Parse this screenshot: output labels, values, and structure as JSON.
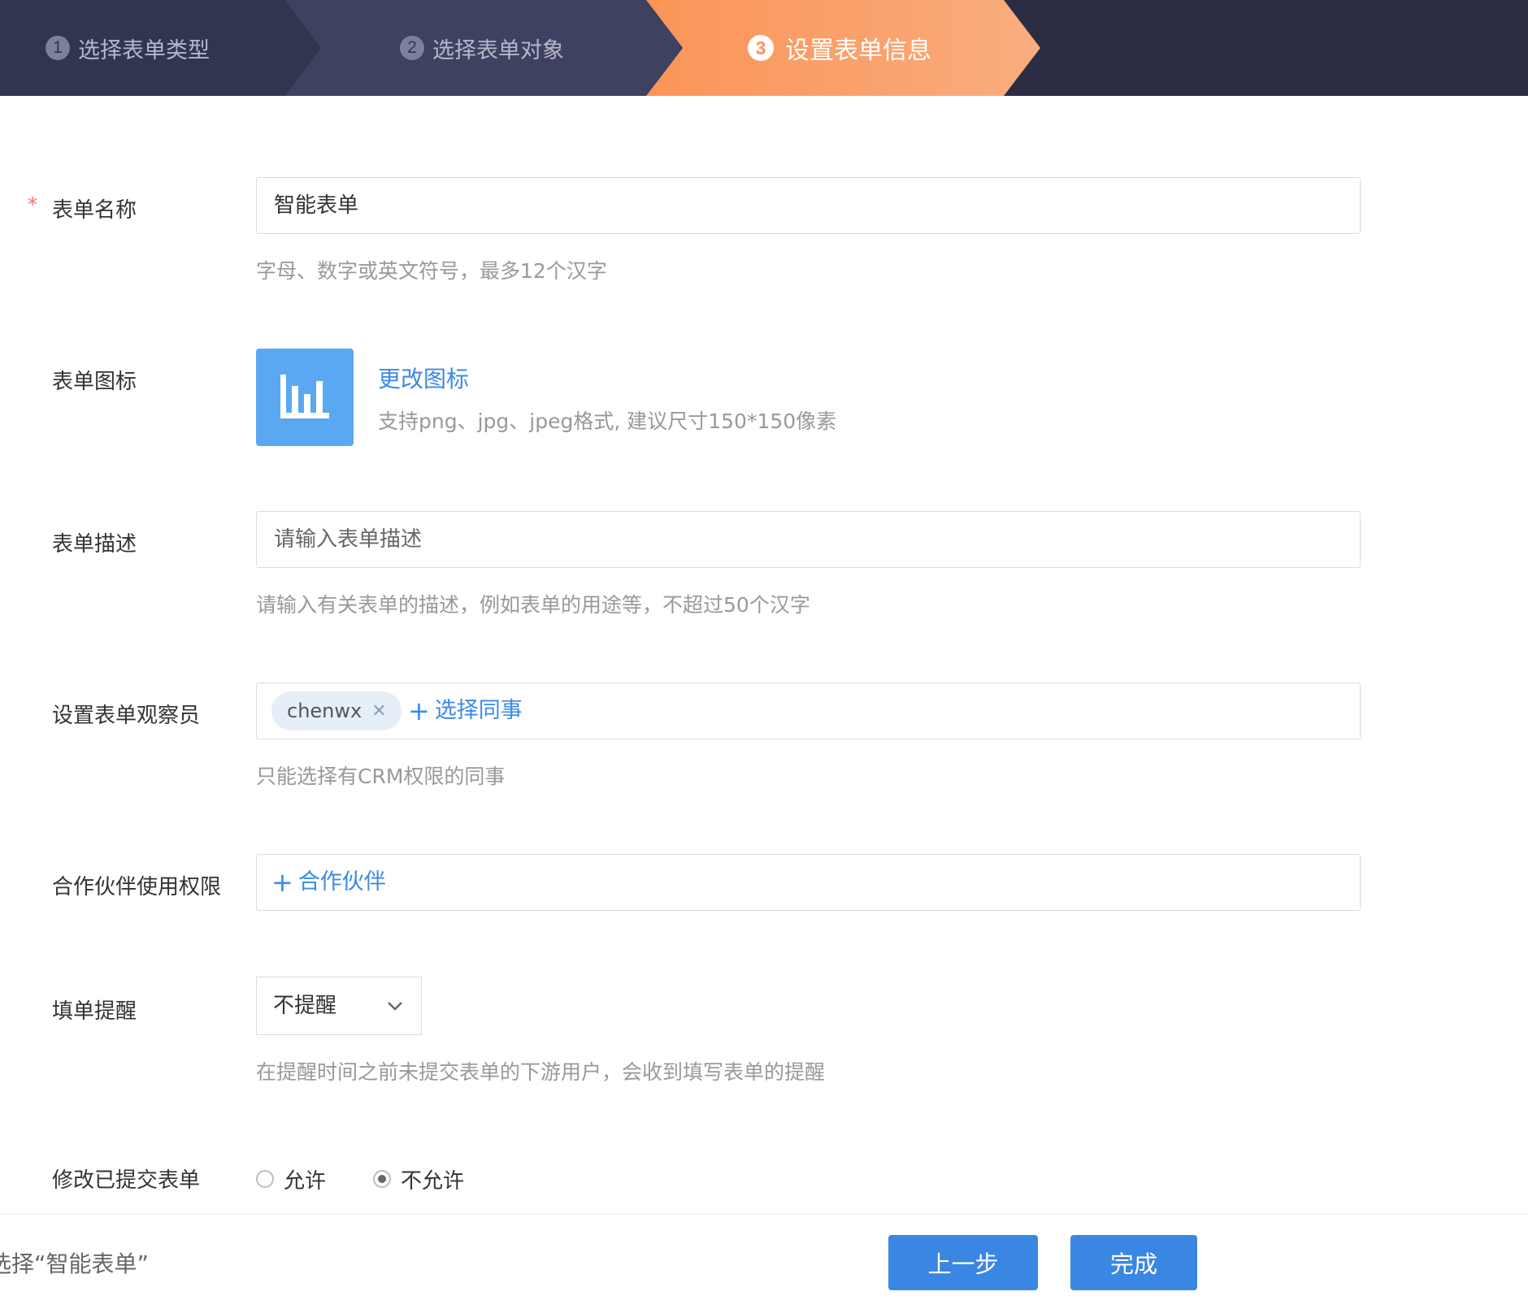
{
  "steps": [
    {
      "number": "1",
      "label": "选择表单类型"
    },
    {
      "number": "2",
      "label": "选择表单对象"
    },
    {
      "number": "3",
      "label": "设置表单信息"
    }
  ],
  "form": {
    "name": {
      "required_mark": "*",
      "label": "表单名称",
      "value": "智能表单",
      "hint": "字母、数字或英文符号，最多12个汉字"
    },
    "icon": {
      "label": "表单图标",
      "change_link": "更改图标",
      "hint": "支持png、jpg、jpeg格式, 建议尺寸150*150像素",
      "icon_name": "bar-chart-icon",
      "color": "#5aa8f2"
    },
    "description": {
      "label": "表单描述",
      "placeholder": "请输入表单描述",
      "hint": "请输入有关表单的描述，例如表单的用途等，不超过50个汉字"
    },
    "observers": {
      "label": "设置表单观察员",
      "tag": "chenwx",
      "tag_close": "✕",
      "add_link": "选择同事",
      "hint": "只能选择有CRM权限的同事"
    },
    "partner": {
      "label": "合作伙伴使用权限",
      "add_link": "合作伙伴"
    },
    "reminder": {
      "label": "填单提醒",
      "selected": "不提醒",
      "hint": "在提醒时间之前未提交表单的下游用户，会收到填写表单的提醒"
    },
    "modify": {
      "label": "修改已提交表单",
      "options": [
        "允许",
        "不允许"
      ],
      "selected": "不允许"
    }
  },
  "footer": {
    "selection_text": "选择“智能表单”",
    "prev_button": "上一步",
    "done_button": "完成"
  },
  "colors": {
    "accent": "#3a87e3",
    "step_active": "#fb9458",
    "header_bg": "#2b2d45"
  }
}
